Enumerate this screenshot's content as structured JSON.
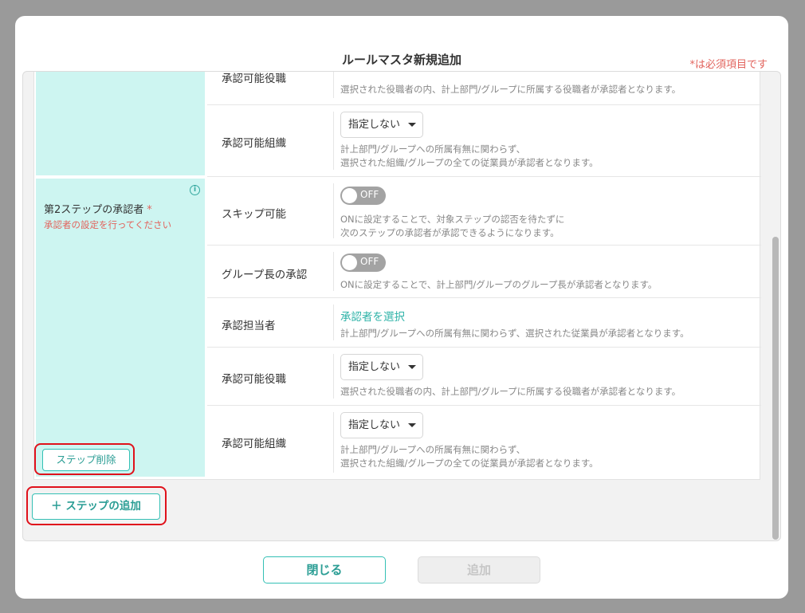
{
  "modal": {
    "title": "ルールマスタ新規追加",
    "required_note": "*は必須項目です"
  },
  "step1": {
    "rows": [
      {
        "label": "承認可能役職",
        "description": "選択された役職者の内、計上部門/グループに所属する役職者が承認者となります。"
      },
      {
        "label": "承認可能組織",
        "select_value": "指定しない",
        "description_line1": "計上部門/グループへの所属有無に関わらず、",
        "description_line2": "選択された組織/グループの全ての従業員が承認者となります。"
      }
    ]
  },
  "step2": {
    "title": "第2ステップの承認者",
    "required_mark": "*",
    "warning": "承認者の設定を行ってください",
    "info_icon": "info-icon",
    "delete_label": "ステップ削除",
    "rows": [
      {
        "label": "スキップ可能",
        "toggle_text": "OFF",
        "description_line1": "ONに設定することで、対象ステップの認否を待たずに",
        "description_line2": "次のステップの承認者が承認できるようになります。"
      },
      {
        "label": "グループ長の承認",
        "toggle_text": "OFF",
        "description": "ONに設定することで、計上部門/グループのグループ長が承認者となります。"
      },
      {
        "label": "承認担当者",
        "link": "承認者を選択",
        "description": "計上部門/グループへの所属有無に関わらず、選択された従業員が承認者となります。"
      },
      {
        "label": "承認可能役職",
        "select_value": "指定しない",
        "description": "選択された役職者の内、計上部門/グループに所属する役職者が承認者となります。"
      },
      {
        "label": "承認可能組織",
        "select_value": "指定しない",
        "description_line1": "計上部門/グループへの所属有無に関わらず、",
        "description_line2": "選択された組織/グループの全ての従業員が承認者となります。"
      }
    ]
  },
  "add_step": {
    "icon": "plus-icon",
    "label": "ステップの追加"
  },
  "footer": {
    "close_label": "閉じる",
    "add_label": "追加"
  },
  "colors": {
    "accent": "#34c0b5",
    "step_bg": "#cdf5f1",
    "error": "#e2645d",
    "highlight": "#e0111b"
  }
}
